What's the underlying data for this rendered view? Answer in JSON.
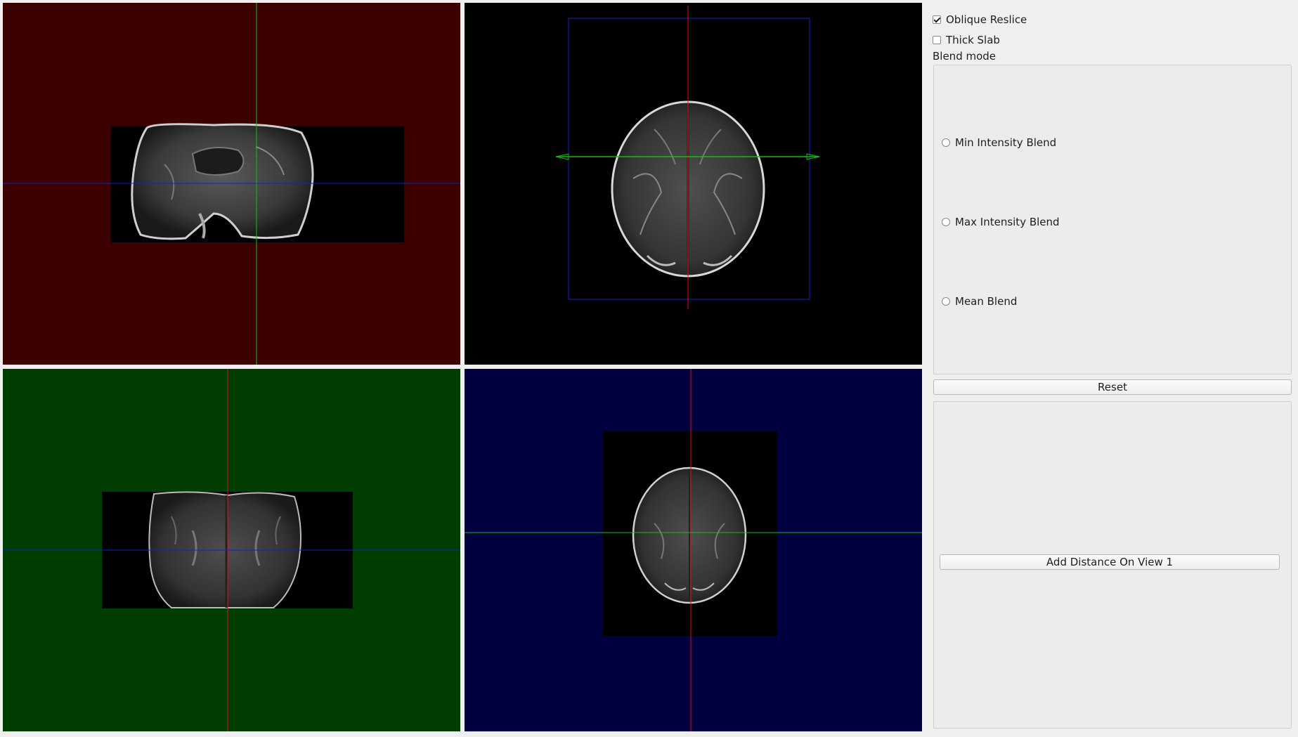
{
  "controls": {
    "oblique_reslice": {
      "label": "Oblique Reslice",
      "checked": true
    },
    "thick_slab": {
      "label": "Thick Slab",
      "checked": false
    },
    "blend_mode": {
      "title": "Blend mode",
      "options": [
        {
          "label": "Min Intensity Blend",
          "selected": false
        },
        {
          "label": "Max Intensity Blend",
          "selected": false
        },
        {
          "label": "Mean Blend",
          "selected": false
        }
      ]
    },
    "reset_label": "Reset",
    "add_distance_label": "Add Distance On View 1"
  },
  "colors": {
    "sagittal_bg": "#3c0000",
    "axial_bg": "#000000",
    "coronal_bg": "#003d00",
    "view3d_bg": "#000040",
    "cursor_red": "#e01010",
    "cursor_green": "#10c010",
    "cursor_blue": "#1020d0"
  }
}
